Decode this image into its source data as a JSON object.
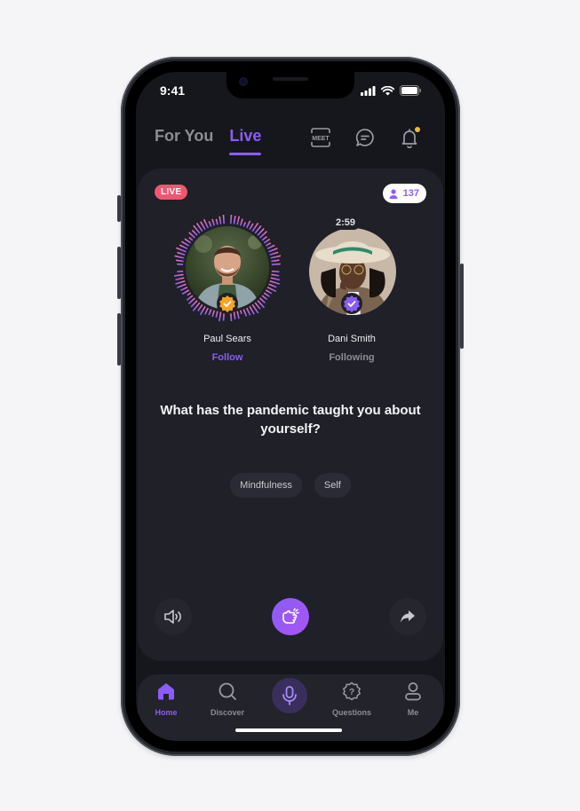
{
  "status_bar": {
    "time": "9:41"
  },
  "header": {
    "tabs": [
      {
        "label": "For You",
        "active": false
      },
      {
        "label": "Live",
        "active": true
      }
    ],
    "icons": [
      "meet-icon",
      "chat-icon",
      "bell-icon"
    ],
    "meet_label": "MEET",
    "notification_dot_color": "#f5b82e"
  },
  "room": {
    "live_label": "LIVE",
    "listener_count": "137",
    "speakers": [
      {
        "name": "Paul Sears",
        "action": "Follow",
        "speaking": true,
        "verified_color": "#f5a524"
      },
      {
        "name": "Dani Smith",
        "action": "Following",
        "timer": "2:59",
        "verified_color": "#8b5cf6"
      }
    ],
    "question": "What has the pandemic taught you about yourself?",
    "tags": [
      "Mindfulness",
      "Self"
    ]
  },
  "controls": [
    "speaker-icon",
    "clap-icon",
    "share-icon"
  ],
  "tabbar": {
    "items": [
      {
        "label": "Home",
        "icon": "home-icon",
        "active": true
      },
      {
        "label": "Discover",
        "icon": "search-icon",
        "active": false
      },
      {
        "label": "",
        "icon": "mic-icon",
        "active": false
      },
      {
        "label": "Questions",
        "icon": "question-badge-icon",
        "active": false
      },
      {
        "label": "Me",
        "icon": "user-icon",
        "active": false
      }
    ]
  },
  "colors": {
    "accent": "#8b5cf6",
    "live": "#f0566f",
    "background": "#16171c",
    "card": "#1f2028"
  }
}
